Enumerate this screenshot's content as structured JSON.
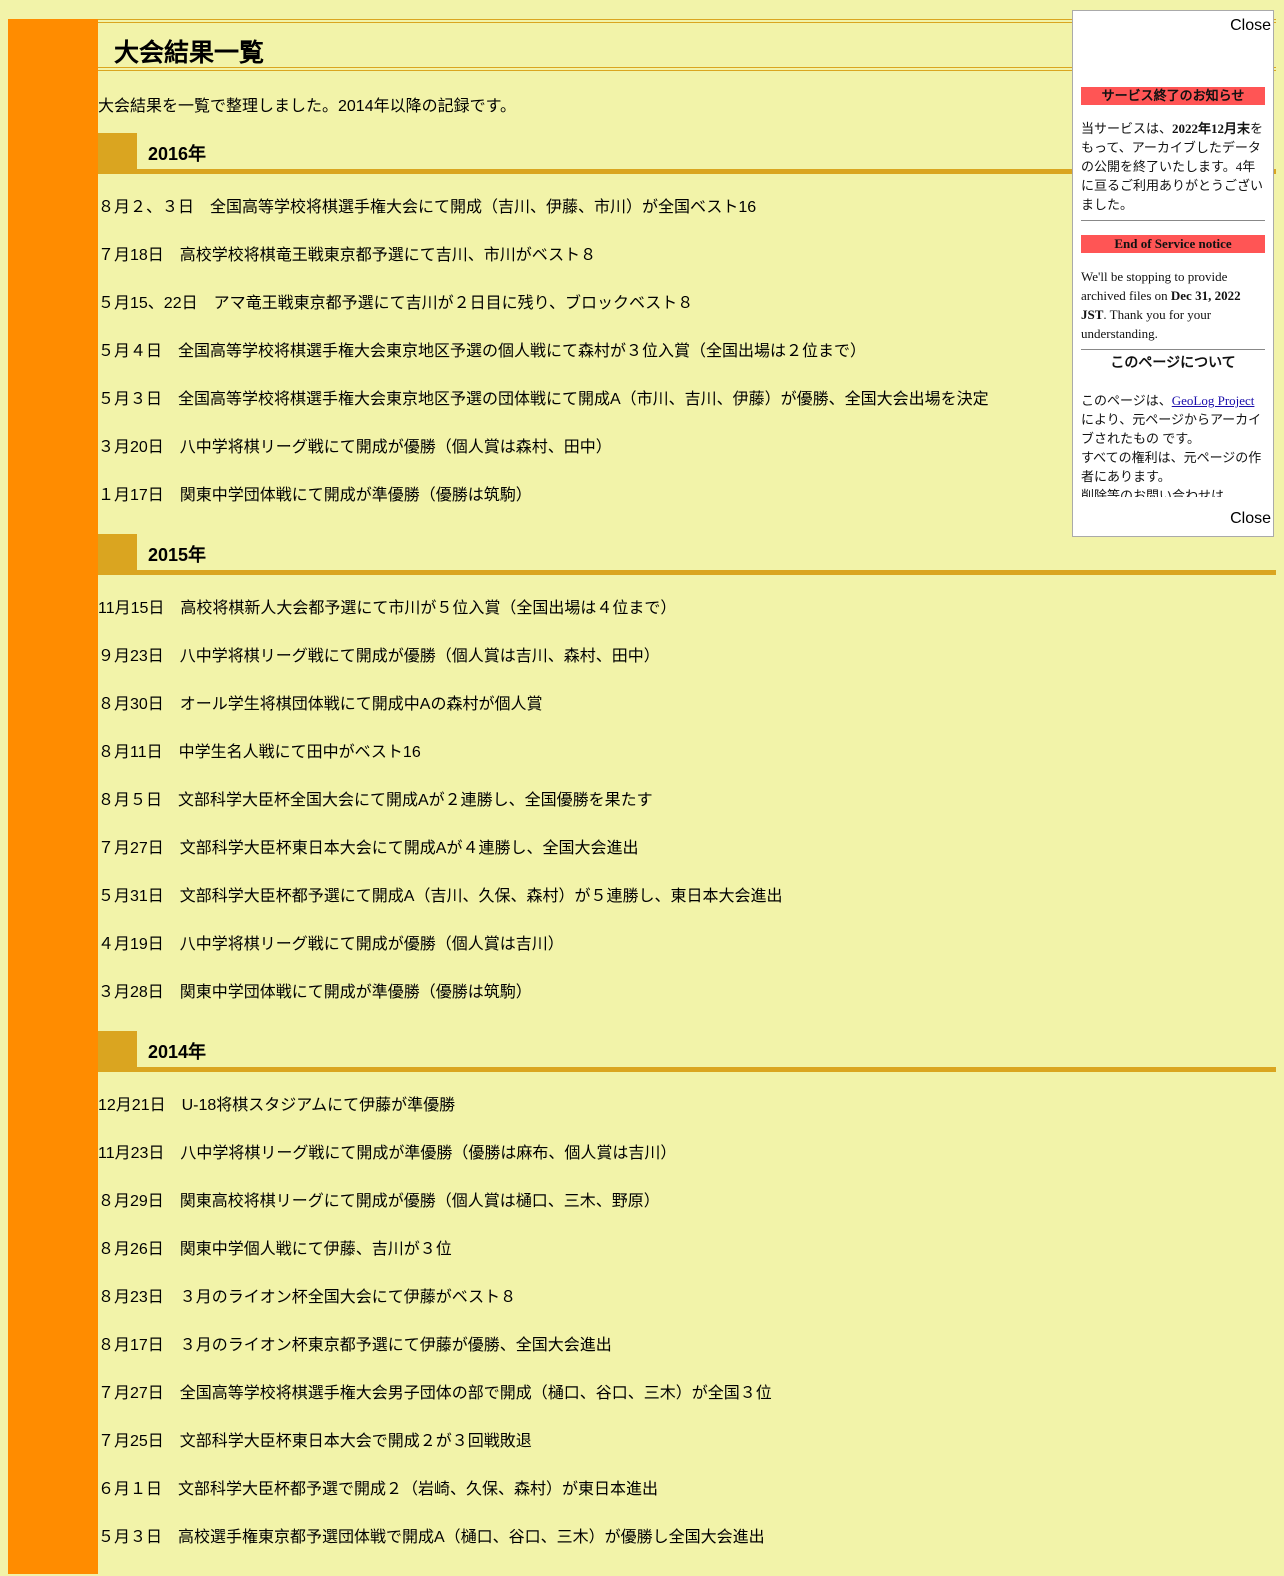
{
  "page": {
    "title": "大会結果一覧",
    "intro": "大会結果を一覧で整理しました。2014年以降の記録です。"
  },
  "years": [
    {
      "label": "2016年",
      "events": [
        "８月２、３日　全国高等学校将棋選手権大会にて開成（吉川、伊藤、市川）が全国ベスト16",
        "７月18日　高校学校将棋竜王戦東京都予選にて吉川、市川がベスト８",
        "５月15、22日　アマ竜王戦東京都予選にて吉川が２日目に残り、ブロックベスト８",
        "５月４日　全国高等学校将棋選手権大会東京地区予選の個人戦にて森村が３位入賞（全国出場は２位まで）",
        "５月３日　全国高等学校将棋選手権大会東京地区予選の団体戦にて開成A（市川、吉川、伊藤）が優勝、全国大会出場を決定",
        "３月20日　八中学将棋リーグ戦にて開成が優勝（個人賞は森村、田中）",
        "１月17日　関東中学団体戦にて開成が準優勝（優勝は筑駒）"
      ]
    },
    {
      "label": "2015年",
      "events": [
        "11月15日　高校将棋新人大会都予選にて市川が５位入賞（全国出場は４位まで）",
        "９月23日　八中学将棋リーグ戦にて開成が優勝（個人賞は吉川、森村、田中）",
        "８月30日　オール学生将棋団体戦にて開成中Aの森村が個人賞",
        "８月11日　中学生名人戦にて田中がベスト16",
        "８月５日　文部科学大臣杯全国大会にて開成Aが２連勝し、全国優勝を果たす",
        "７月27日　文部科学大臣杯東日本大会にて開成Aが４連勝し、全国大会進出",
        "５月31日　文部科学大臣杯都予選にて開成A（吉川、久保、森村）が５連勝し、東日本大会進出",
        "４月19日　八中学将棋リーグ戦にて開成が優勝（個人賞は吉川）",
        "３月28日　関東中学団体戦にて開成が準優勝（優勝は筑駒）"
      ]
    },
    {
      "label": "2014年",
      "events": [
        "12月21日　U-18将棋スタジアムにて伊藤が準優勝",
        "11月23日　八中学将棋リーグ戦にて開成が準優勝（優勝は麻布、個人賞は吉川）",
        "８月29日　関東高校将棋リーグにて開成が優勝（個人賞は樋口、三木、野原）",
        "８月26日　関東中学個人戦にて伊藤、吉川が３位",
        "８月23日　３月のライオン杯全国大会にて伊藤がベスト８",
        "８月17日　３月のライオン杯東京都予選にて伊藤が優勝、全国大会進出",
        "７月27日　全国高等学校将棋選手権大会男子団体の部で開成（樋口、谷口、三木）が全国３位",
        "７月25日　文部科学大臣杯東日本大会で開成２が３回戦敗退",
        "６月１日　文部科学大臣杯都予選で開成２（岩崎、久保、森村）が東日本進出",
        "５月３日　高校選手権東京都予選団体戦で開成A（樋口、谷口、三木）が優勝し全国大会進出"
      ]
    }
  ],
  "overlay": {
    "close_label": "Close",
    "jp_notice_title": "サービス終了のお知らせ",
    "jp_notice_pre": "当サービスは、",
    "jp_notice_bold": "2022年12月末",
    "jp_notice_post": "をもって、アーカイブしたデータの公開を終了いたします。4年に亘るご利用ありがとうございました。",
    "en_notice_title": "End of Service notice",
    "en_notice_pre": "We'll be stopping to provide archived files on ",
    "en_notice_bold": "Dec 31, 2022 JST",
    "en_notice_post": ". Thank you for your understanding.",
    "about_title": "このページについて",
    "about_pre": "このページは、",
    "about_link": "GeoLog Project",
    "about_post": "により、元ページからアーカイブされたもの です。",
    "rights": "すべての権利は、元ページの作者にあります。",
    "contact": "削除等のお問い合わせは"
  },
  "colors": {
    "background": "#f2f3a9",
    "sidebar": "#ff8c00",
    "accent": "#daa520",
    "notice": "#ff5555"
  }
}
